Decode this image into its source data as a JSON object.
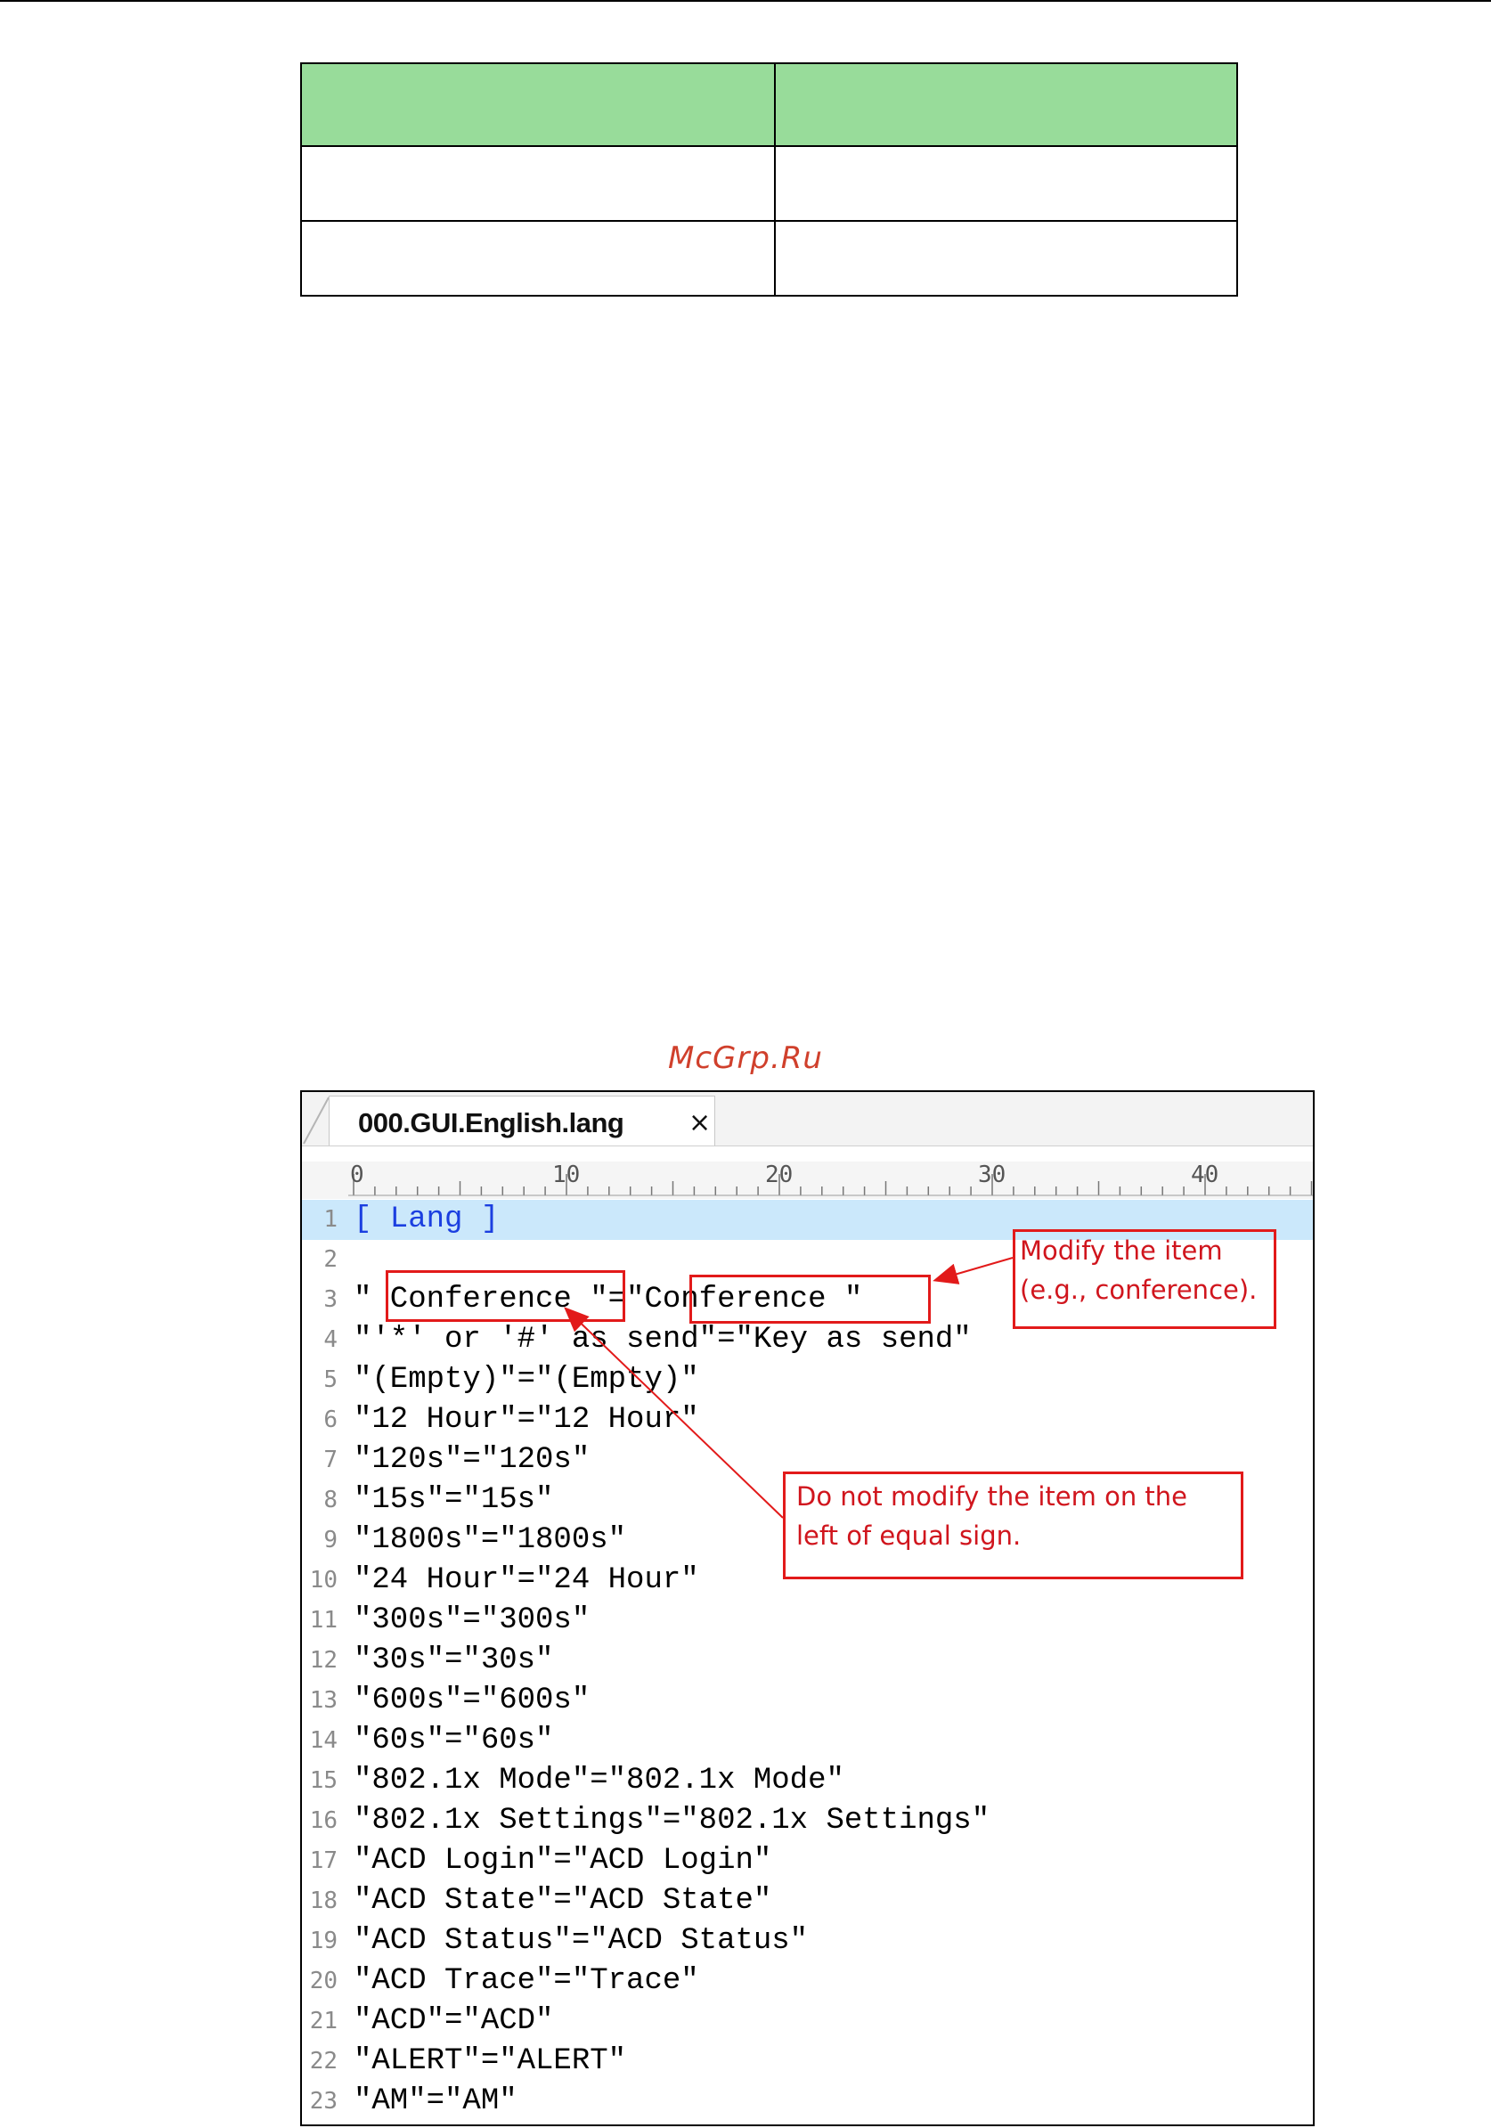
{
  "table": {
    "header": [
      "",
      ""
    ],
    "rows": [
      [
        "",
        ""
      ],
      [
        "",
        ""
      ]
    ]
  },
  "watermark": "McGrp.Ru",
  "editor": {
    "tab_label": "000.GUI.English.lang",
    "tab_close": "×",
    "ruler_numbers": [
      "0",
      "10",
      "20",
      "30",
      "40"
    ],
    "lines": [
      {
        "n": "1",
        "text": "[ Lang ]"
      },
      {
        "n": "2",
        "text": ""
      },
      {
        "n": "3",
        "text": "\" Conference \"=\"Conference \""
      },
      {
        "n": "4",
        "text": "\"'*' or '#' as send\"=\"Key as send\""
      },
      {
        "n": "5",
        "text": "\"(Empty)\"=\"(Empty)\""
      },
      {
        "n": "6",
        "text": "\"12 Hour\"=\"12 Hour\""
      },
      {
        "n": "7",
        "text": "\"120s\"=\"120s\""
      },
      {
        "n": "8",
        "text": "\"15s\"=\"15s\""
      },
      {
        "n": "9",
        "text": "\"1800s\"=\"1800s\""
      },
      {
        "n": "10",
        "text": "\"24 Hour\"=\"24 Hour\""
      },
      {
        "n": "11",
        "text": "\"300s\"=\"300s\""
      },
      {
        "n": "12",
        "text": "\"30s\"=\"30s\""
      },
      {
        "n": "13",
        "text": "\"600s\"=\"600s\""
      },
      {
        "n": "14",
        "text": "\"60s\"=\"60s\""
      },
      {
        "n": "15",
        "text": "\"802.1x Mode\"=\"802.1x Mode\""
      },
      {
        "n": "16",
        "text": "\"802.1x Settings\"=\"802.1x Settings\""
      },
      {
        "n": "17",
        "text": "\"ACD Login\"=\"ACD Login\""
      },
      {
        "n": "18",
        "text": "\"ACD State\"=\"ACD State\""
      },
      {
        "n": "19",
        "text": "\"ACD Status\"=\"ACD Status\""
      },
      {
        "n": "20",
        "text": "\"ACD Trace\"=\"Trace\""
      },
      {
        "n": "21",
        "text": "\"ACD\"=\"ACD\""
      },
      {
        "n": "22",
        "text": "\"ALERT\"=\"ALERT\""
      },
      {
        "n": "23",
        "text": "\"AM\"=\"AM\""
      }
    ],
    "callouts": {
      "modify": "Modify the item\n(e.g., conference).",
      "do_not_modify": "Do not modify the item on the\nleft of equal sign."
    },
    "colors": {
      "annotation": "#e21a1a",
      "highlight_line": "#cbe8fb",
      "header_green": "#98dc9a"
    }
  }
}
